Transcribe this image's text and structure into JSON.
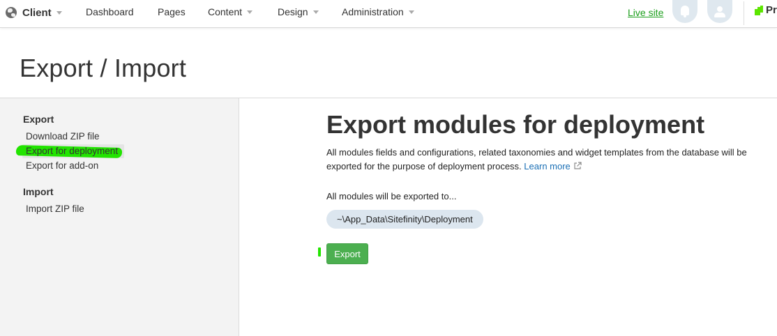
{
  "topbar": {
    "site_name": "Client",
    "nav": [
      {
        "label": "Dashboard",
        "has_caret": false
      },
      {
        "label": "Pages",
        "has_caret": false
      },
      {
        "label": "Content",
        "has_caret": true
      },
      {
        "label": "Design",
        "has_caret": true
      },
      {
        "label": "Administration",
        "has_caret": true
      }
    ],
    "live_site_label": "Live site",
    "logo_text": "Pr",
    "icons": [
      "globe-icon",
      "bell-icon",
      "user-icon",
      "progress-logo"
    ]
  },
  "page": {
    "title": "Export / Import"
  },
  "sidebar": {
    "sections": [
      {
        "heading": "Export",
        "items": [
          {
            "label": "Download ZIP file",
            "active": false
          },
          {
            "label": "Export for deployment",
            "active": true
          },
          {
            "label": "Export for add-on",
            "active": false
          }
        ]
      },
      {
        "heading": "Import",
        "items": [
          {
            "label": "Import ZIP file",
            "active": false
          }
        ]
      }
    ]
  },
  "main": {
    "title": "Export modules for deployment",
    "description": "All modules fields and configurations, related taxonomies and widget templates from the database will be exported for the purpose of deployment process.",
    "learn_more_label": "Learn more",
    "export_to_label": "All modules will be exported to...",
    "export_path": "~\\App_Data\\Sitefinity\\Deployment",
    "export_button_label": "Export"
  },
  "colors": {
    "accent_green": "#4caf50",
    "link_blue": "#1a6fb5",
    "live_site_green": "#1a9e1a",
    "highlight_green": "#22e400"
  }
}
